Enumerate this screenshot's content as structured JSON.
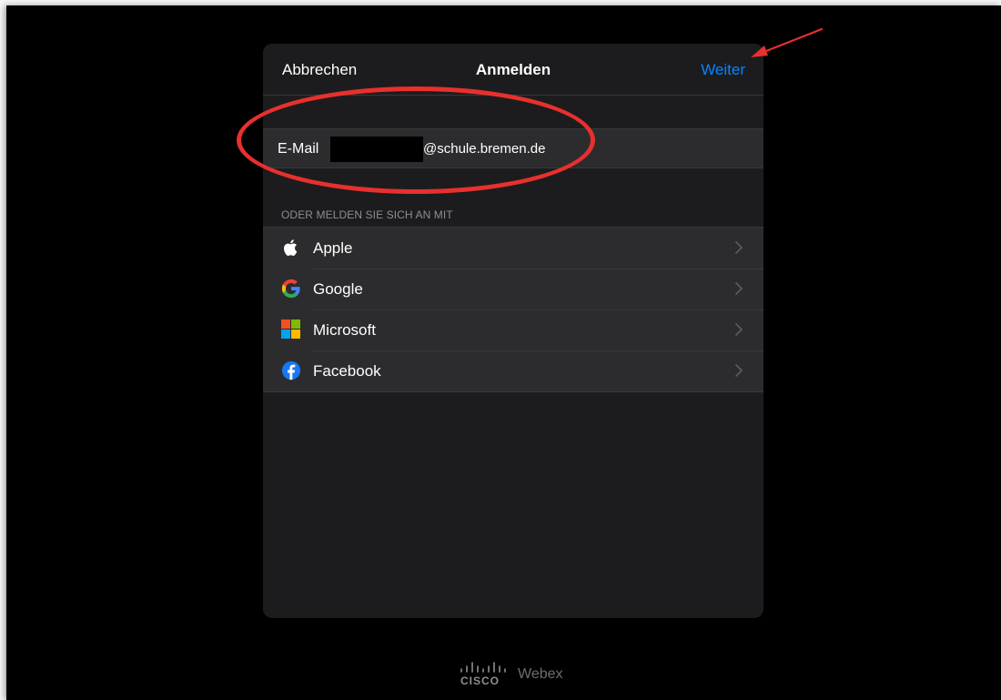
{
  "navbar": {
    "cancel_label": "Abbrechen",
    "title": "Anmelden",
    "next_label": "Weiter"
  },
  "email": {
    "label": "E-Mail",
    "value": "@schule.bremen.de"
  },
  "alternatives": {
    "header": "ODER MELDEN SIE SICH AN MIT",
    "items": [
      {
        "label": "Apple",
        "icon": "apple-icon"
      },
      {
        "label": "Google",
        "icon": "google-icon"
      },
      {
        "label": "Microsoft",
        "icon": "microsoft-icon"
      },
      {
        "label": "Facebook",
        "icon": "facebook-icon"
      }
    ]
  },
  "footer": {
    "brand": "CISCO",
    "product": "Webex"
  },
  "colors": {
    "accent": "#0a84ff",
    "annotation": "#e8302d",
    "sheet_background": "#1c1c1e",
    "row_background": "#2c2c2e"
  }
}
